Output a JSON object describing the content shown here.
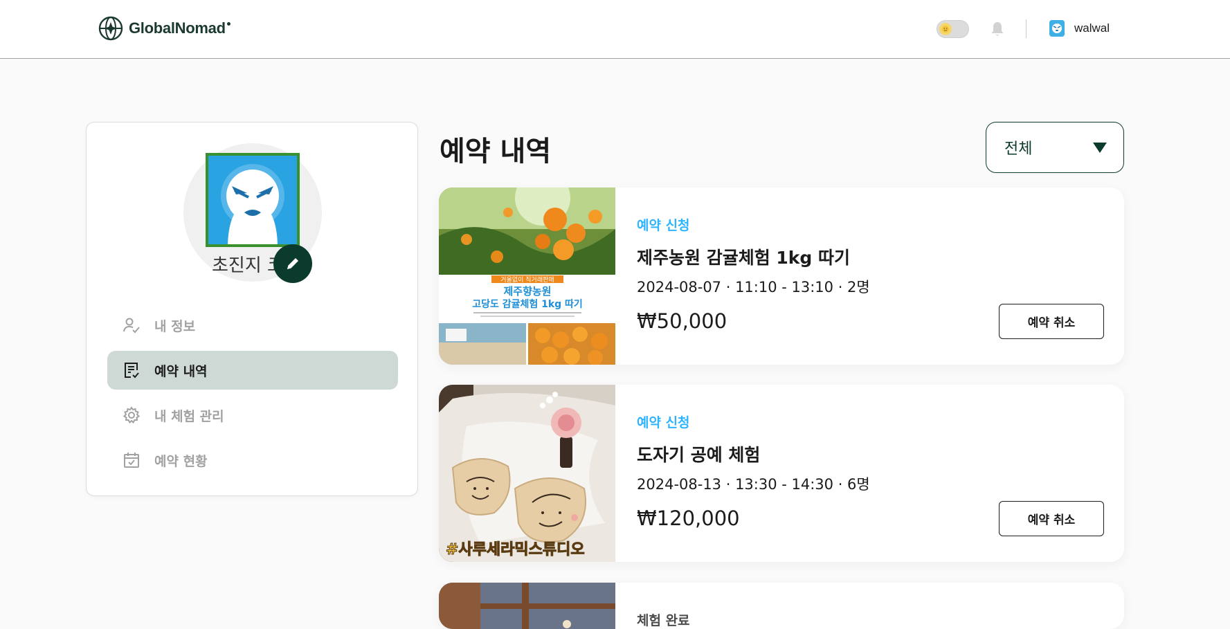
{
  "header": {
    "logo_text": "GlobalNomad",
    "user_name": "walwal"
  },
  "sidebar": {
    "profile_name": "초진지 코",
    "items": [
      {
        "label": "내 정보",
        "icon": "user-check-icon",
        "active": false
      },
      {
        "label": "예약 내역",
        "icon": "list-check-icon",
        "active": true
      },
      {
        "label": "내 체험 관리",
        "icon": "gear-icon",
        "active": false
      },
      {
        "label": "예약 현황",
        "icon": "calendar-check-icon",
        "active": false
      }
    ]
  },
  "main": {
    "title": "예약 내역",
    "filter": {
      "selected": "전체"
    },
    "reservations": [
      {
        "status": "예약 신청",
        "status_color": "#2eb4ff",
        "title": "제주농원 감귤체험 1kg 따기",
        "info": "2024-08-07 · 11:10 - 13:10 · 2명",
        "price": "₩50,000",
        "cancel_label": "예약 취소",
        "image": {
          "banner_small": "거울없이 직거래판매",
          "banner_line1": "제주향농원",
          "banner_line2": "고당도 감귤체험 1kg 따기"
        }
      },
      {
        "status": "예약 신청",
        "status_color": "#2eb4ff",
        "title": "도자기 공예 체험",
        "info": "2024-08-13 · 13:30 - 14:30 · 6명",
        "price": "₩120,000",
        "cancel_label": "예약 취소",
        "image": {
          "caption": "#사루세라믹스튜디오"
        }
      },
      {
        "status": "체험 완료",
        "status_color": "#4b4b4b"
      }
    ]
  }
}
